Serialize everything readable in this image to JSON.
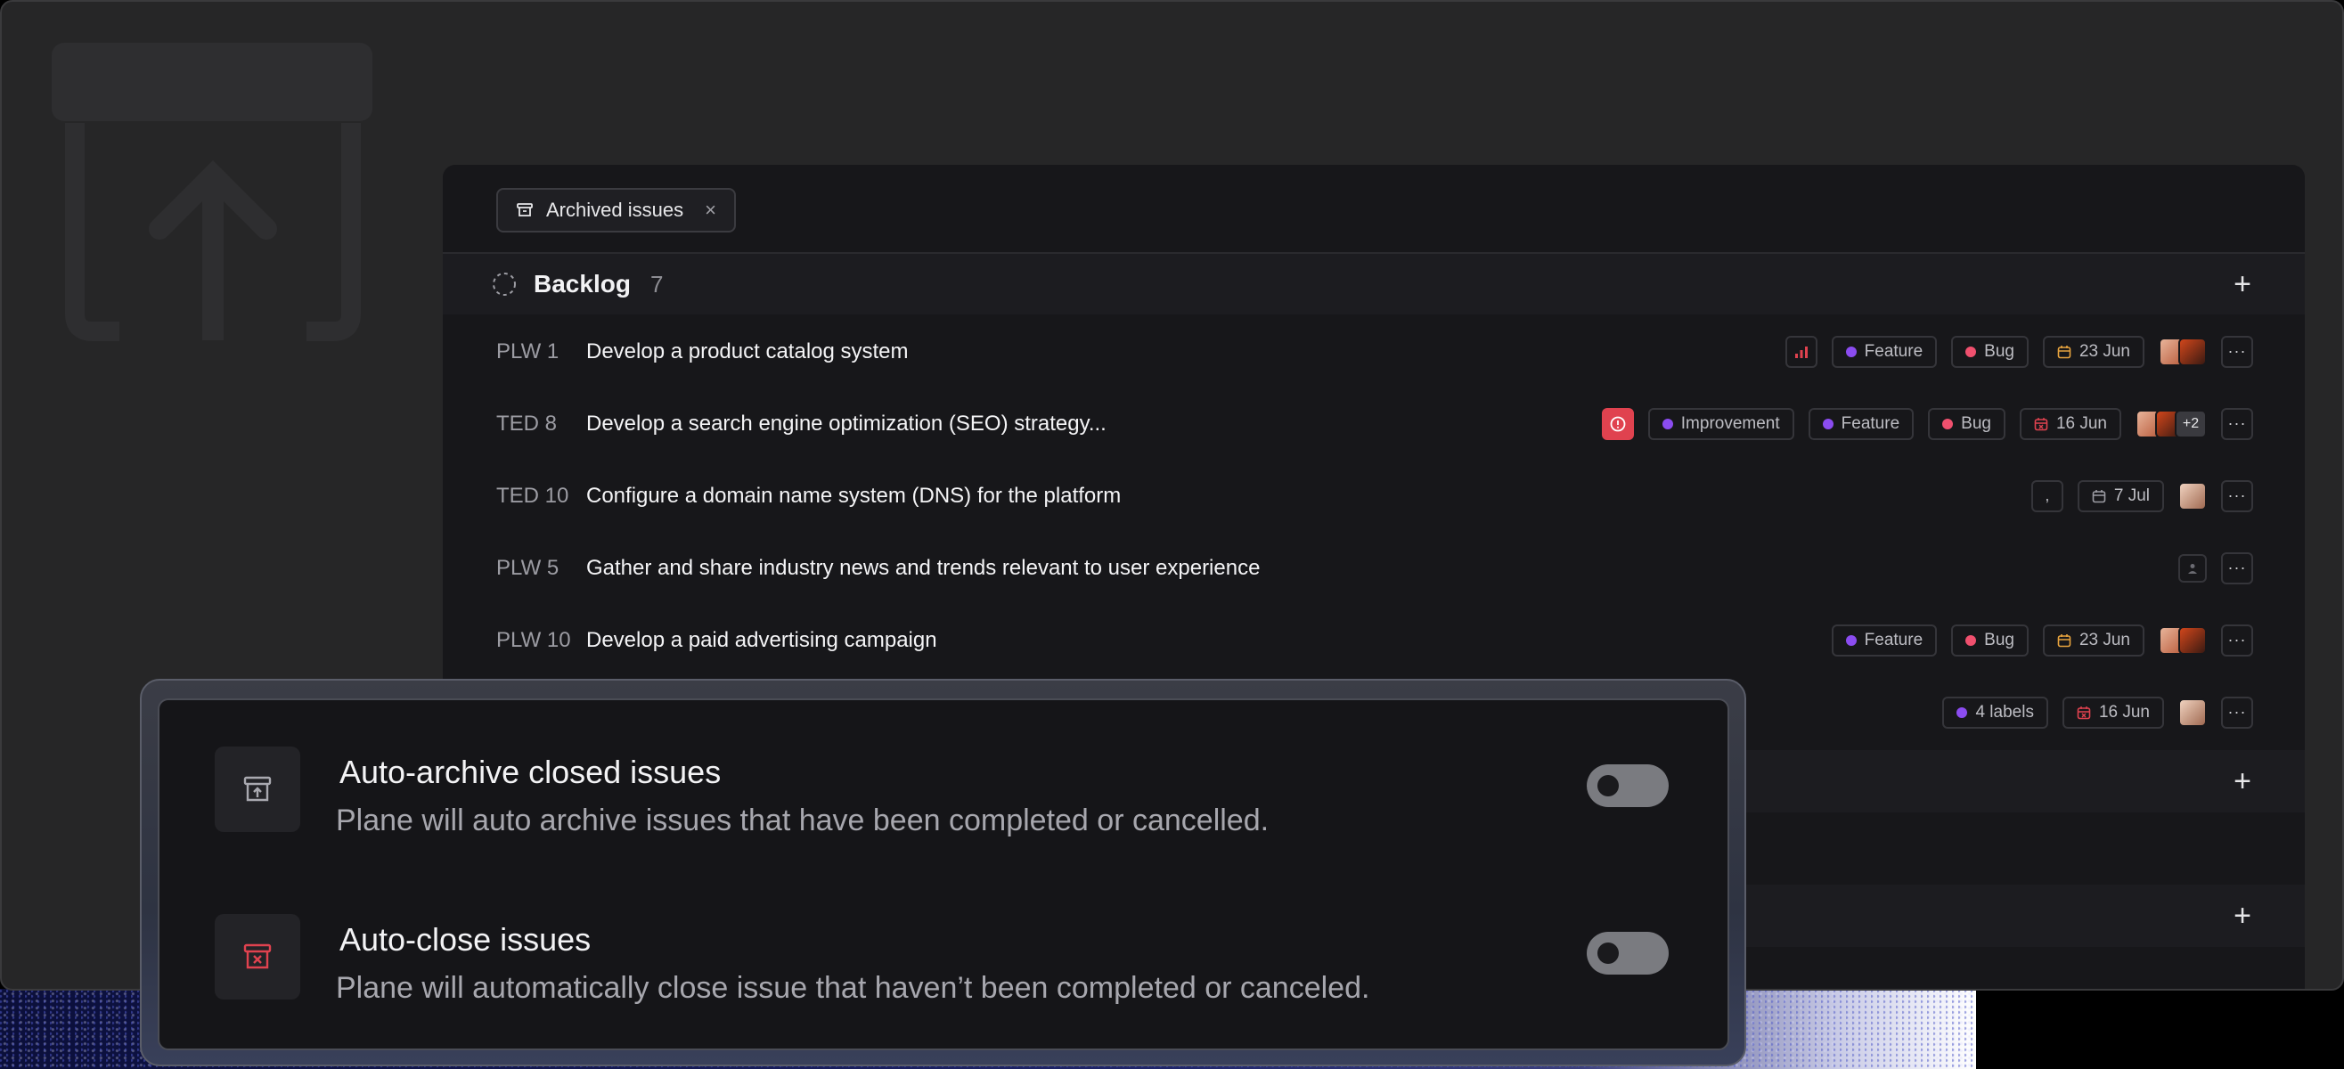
{
  "filter_chip": {
    "label": "Archived issues",
    "close": "×"
  },
  "group": {
    "name": "Backlog",
    "count": "7",
    "add": "+"
  },
  "rows": [
    {
      "id": "PLW 1",
      "title": "Develop a product catalog system",
      "labels": [
        "Feature",
        "Bug"
      ],
      "date": "23 Jun"
    },
    {
      "id": "TED 8",
      "title": "Develop a search engine optimization (SEO) strategy...",
      "labels": [
        "Improvement",
        "Feature",
        "Bug"
      ],
      "date": "16 Jun",
      "extra_assignees": "+2"
    },
    {
      "id": "TED 10",
      "title": "Configure a domain name system (DNS) for the platform",
      "estimate": ",",
      "date": "7 Jul"
    },
    {
      "id": "PLW 5",
      "title": "Gather and share industry news and trends relevant to user experience"
    },
    {
      "id": "PLW 10",
      "title": "Develop a paid advertising campaign",
      "labels": [
        "Feature",
        "Bug"
      ],
      "date": "23 Jun"
    },
    {
      "labels_count": "4 labels",
      "date": "16 Jun"
    }
  ],
  "more_label": "···",
  "sub_group_add": "+",
  "settings": {
    "auto_archive": {
      "title": "Auto-archive closed issues",
      "description": "Plane will auto archive issues that have been completed or cancelled."
    },
    "auto_close": {
      "title": "Auto-close issues",
      "description": "Plane will automatically close issue that haven’t been completed or canceled."
    }
  },
  "colors": {
    "feature": "#8b4cf0",
    "bug": "#f0506e",
    "improvement": "#8b4cf0",
    "date_warning": "#e7a33e",
    "date_overdue": "#e0424f",
    "urgent": "#e0424f"
  }
}
